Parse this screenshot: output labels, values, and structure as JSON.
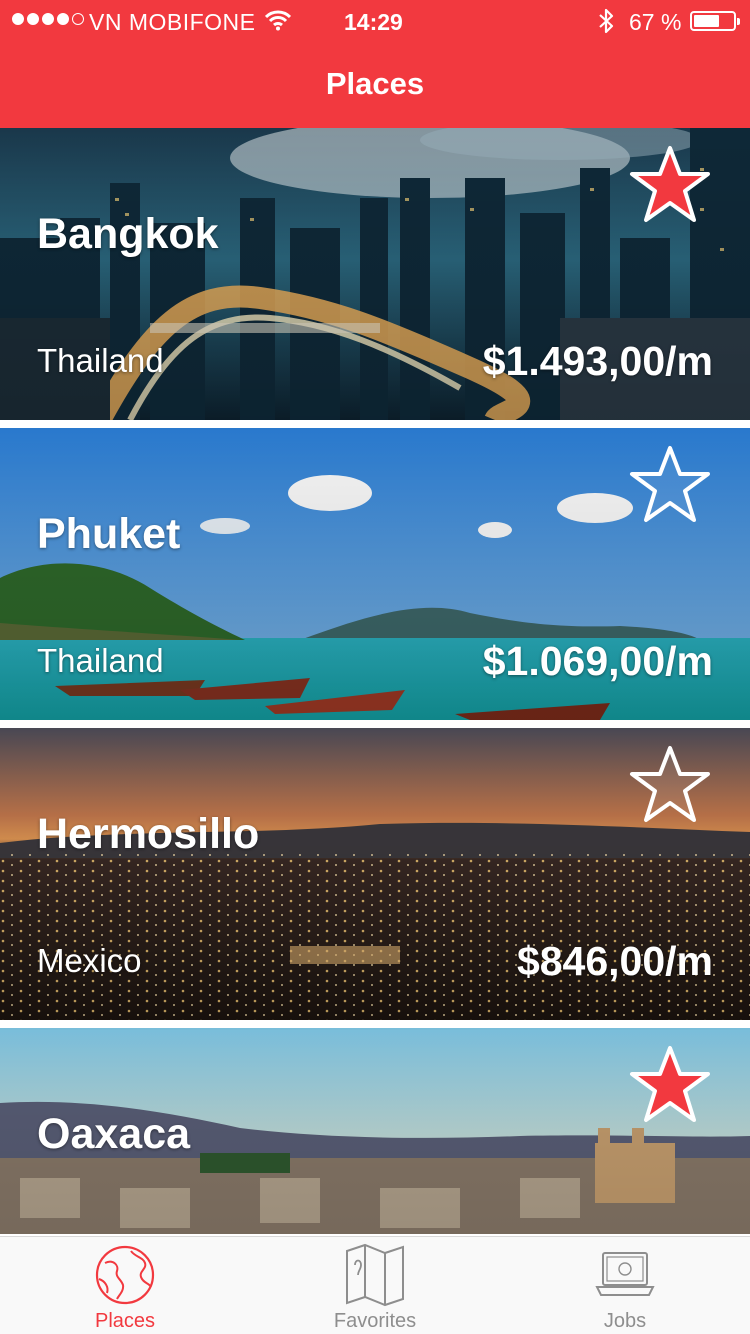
{
  "status_bar": {
    "carrier": "VN MOBIFONE",
    "time": "14:29",
    "battery": "67 %",
    "battery_level": 0.67,
    "signal_bars": 4,
    "signal_total": 5
  },
  "nav": {
    "title": "Places"
  },
  "places": [
    {
      "city": "Bangkok",
      "country": "Thailand",
      "price": "$1.493,00/m",
      "favorite": true
    },
    {
      "city": "Phuket",
      "country": "Thailand",
      "price": "$1.069,00/m",
      "favorite": false
    },
    {
      "city": "Hermosillo",
      "country": "Mexico",
      "price": "$846,00/m",
      "favorite": false
    },
    {
      "city": "Oaxaca",
      "country": "",
      "price": "",
      "favorite": true
    }
  ],
  "tabs": [
    {
      "label": "Places",
      "icon": "globe-icon",
      "active": true
    },
    {
      "label": "Favorites",
      "icon": "map-icon",
      "active": false
    },
    {
      "label": "Jobs",
      "icon": "laptop-icon",
      "active": false
    }
  ],
  "colors": {
    "accent": "#f2393f",
    "inactive": "#8e8e8e",
    "star_fill": "#f2393f"
  }
}
